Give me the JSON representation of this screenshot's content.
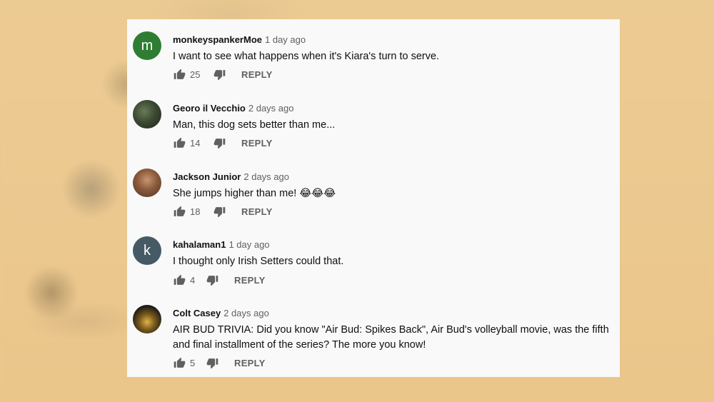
{
  "comments": [
    {
      "author": "monkeyspankerMoe",
      "time": "1 day ago",
      "text": "I want to see what happens when it's Kiara's turn to serve.",
      "likes": "25",
      "avatar_letter": "m",
      "reply_label": "REPLY"
    },
    {
      "author": "Georo il Vecchio",
      "time": "2 days ago",
      "text": "Man, this dog sets better than me...",
      "likes": "14",
      "reply_label": "REPLY"
    },
    {
      "author": "Jackson Junior",
      "time": "2 days ago",
      "text": "She jumps higher than me! 😂😂😂",
      "likes": "18",
      "reply_label": "REPLY"
    },
    {
      "author": "kahalaman1",
      "time": "1 day ago",
      "text": "I thought only Irish Setters could that.",
      "likes": "4",
      "avatar_letter": "k",
      "reply_label": "REPLY"
    },
    {
      "author": "Colt Casey",
      "time": "2 days ago",
      "text": "AIR BUD TRIVIA: Did you know \"Air Bud: Spikes Back\", Air Bud's volleyball movie, was the fifth and final installment of the series? The more you know!",
      "likes": "5",
      "reply_label": "REPLY"
    }
  ],
  "icons": {
    "like": "thumbs-up-icon",
    "dislike": "thumbs-down-icon"
  },
  "colors": {
    "background": "#ecc98f",
    "card": "#f9f9f9",
    "avatar_m": "#2e7d32",
    "avatar_k": "#455a64",
    "secondary_text": "#606060"
  }
}
